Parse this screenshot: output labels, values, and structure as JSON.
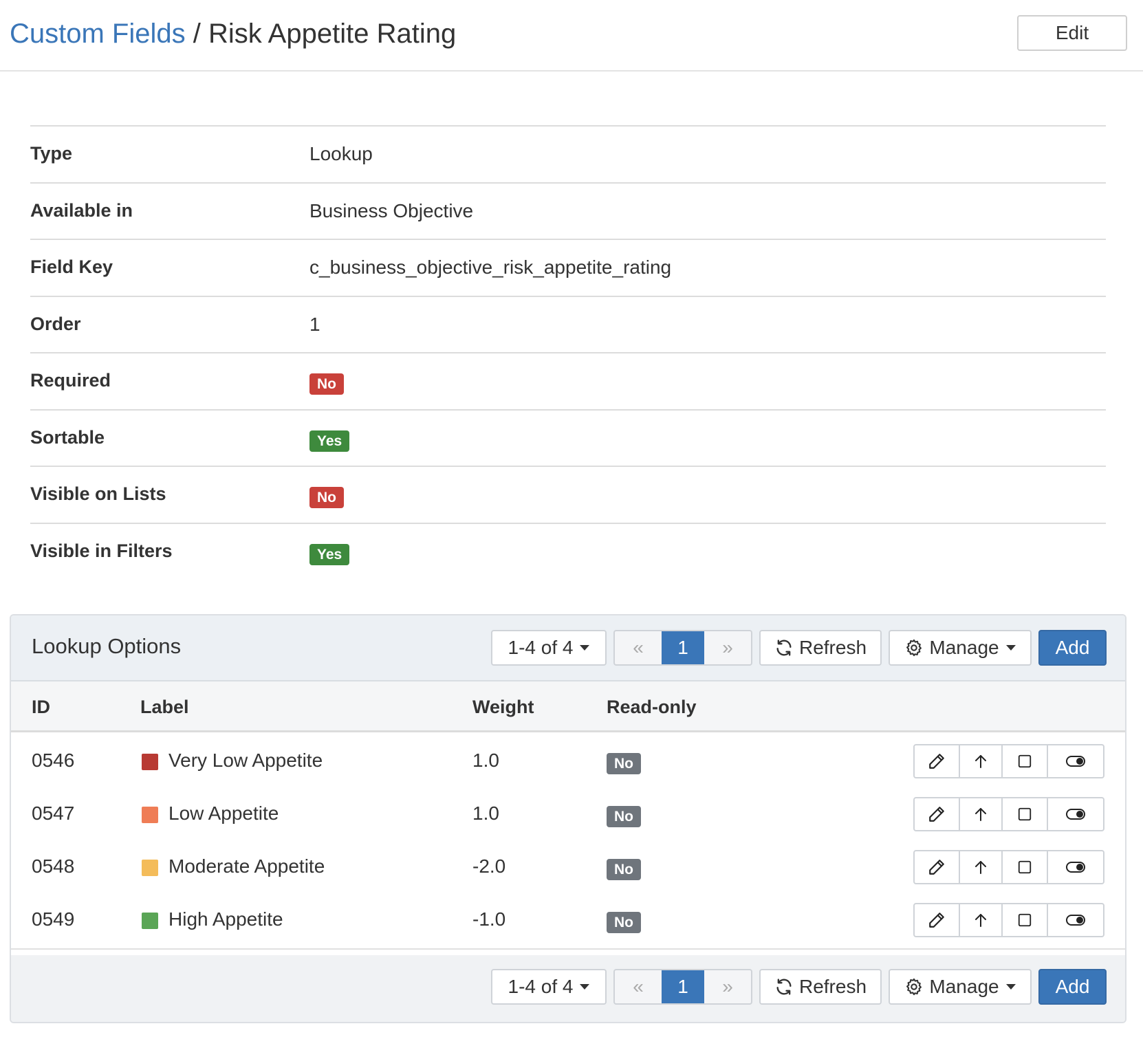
{
  "header": {
    "breadcrumb_link": "Custom Fields",
    "separator": "/",
    "title": "Risk Appetite Rating",
    "edit_label": "Edit"
  },
  "properties": [
    {
      "label": "Type",
      "value": "Lookup"
    },
    {
      "label": "Available in",
      "value": "Business Objective"
    },
    {
      "label": "Field Key",
      "value": "c_business_objective_risk_appetite_rating"
    },
    {
      "label": "Order",
      "value": "1"
    },
    {
      "label": "Required",
      "value": "No",
      "kind": "badge",
      "color": "#c9413a"
    },
    {
      "label": "Sortable",
      "value": "Yes",
      "kind": "badge",
      "color": "#3e8a3d"
    },
    {
      "label": "Visible on Lists",
      "value": "No",
      "kind": "badge",
      "color": "#c9413a"
    },
    {
      "label": "Visible in Filters",
      "value": "Yes",
      "kind": "badge",
      "color": "#3e8a3d"
    }
  ],
  "panel": {
    "title": "Lookup Options",
    "toolbar": {
      "range_label": "1-4 of 4",
      "first_glyph": "«",
      "current_page": "1",
      "next_glyph": "»",
      "refresh_label": "Refresh",
      "manage_label": "Manage",
      "add_label": "Add"
    },
    "columns": [
      "ID",
      "Label",
      "Weight",
      "Read-only"
    ],
    "rows": [
      {
        "id": "0546",
        "label": "Very Low Appetite",
        "color": "#b83a33",
        "weight": "1.0",
        "read_only": "No"
      },
      {
        "id": "0547",
        "label": "Low Appetite",
        "color": "#ef7d56",
        "weight": "1.0",
        "read_only": "No"
      },
      {
        "id": "0548",
        "label": "Moderate Appetite",
        "color": "#f4bc5a",
        "weight": "-2.0",
        "read_only": "No"
      },
      {
        "id": "0549",
        "label": "High Appetite",
        "color": "#5aa556",
        "weight": "-1.0",
        "read_only": "No"
      }
    ],
    "row_actions": [
      "pencil-icon",
      "arrow-up-icon",
      "square-icon",
      "eye-toggle-icon"
    ]
  },
  "colors": {
    "link": "#3a76b8",
    "primary": "#3a76b8",
    "badge_no": "#c9413a",
    "badge_yes": "#3e8a3d",
    "badge_gray": "#6f757c"
  }
}
